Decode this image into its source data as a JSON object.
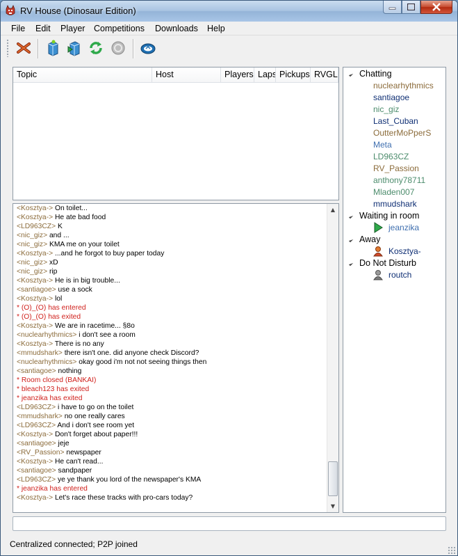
{
  "window": {
    "title": "RV House (Dinosaur Edition)"
  },
  "menu": [
    "File",
    "Edit",
    "Player",
    "Competitions",
    "Downloads",
    "Help"
  ],
  "toolbar": {
    "buttons": [
      "exit-icon",
      "host-icon",
      "join-icon",
      "refresh-icon",
      "stop-icon",
      "connection-icon"
    ]
  },
  "rooms": {
    "columns": [
      "Topic",
      "Host",
      "Players",
      "Laps",
      "Pickups",
      "RVGL"
    ],
    "rows": []
  },
  "chat": {
    "lines": [
      {
        "nick": "<Kosztya->",
        "text": " On toilet...",
        "type": "msg"
      },
      {
        "nick": "<Kosztya->",
        "text": " He ate bad food",
        "type": "msg"
      },
      {
        "nick": "<LD963CZ>",
        "text": " K",
        "type": "msg"
      },
      {
        "nick": "<nic_giz>",
        "text": " and ...",
        "type": "msg"
      },
      {
        "nick": "<nic_giz>",
        "text": " KMA me on your toilet",
        "type": "msg"
      },
      {
        "nick": "<Kosztya->",
        "text": " ...and he forgot to buy paper today",
        "type": "msg"
      },
      {
        "nick": "<nic_giz>",
        "text": " xD",
        "type": "msg"
      },
      {
        "nick": "<nic_giz>",
        "text": " rip",
        "type": "msg"
      },
      {
        "nick": "<Kosztya->",
        "text": " He is in big trouble...",
        "type": "msg"
      },
      {
        "nick": "<santiagoe>",
        "text": " use a sock",
        "type": "msg"
      },
      {
        "nick": "<Kosztya->",
        "text": " lol",
        "type": "msg"
      },
      {
        "nick": "",
        "text": "* (O)_(O) has entered",
        "type": "sys"
      },
      {
        "nick": "",
        "text": "* (O)_(O) has exited",
        "type": "sys"
      },
      {
        "nick": "<Kosztya->",
        "text": " We are in racetime... §8o",
        "type": "msg"
      },
      {
        "nick": "<nuclearhythmics>",
        "text": " i don't see a room",
        "type": "msg"
      },
      {
        "nick": "<Kosztya->",
        "text": " There is no any",
        "type": "msg"
      },
      {
        "nick": "<mmudshark>",
        "text": " there isn't one.  did anyone check Discord?",
        "type": "msg"
      },
      {
        "nick": "<nuclearhythmics>",
        "text": " okay good i'm not not seeing things then",
        "type": "msg"
      },
      {
        "nick": "<santiagoe>",
        "text": " nothing",
        "type": "msg"
      },
      {
        "nick": "",
        "text": "* Room closed (BANKAI)",
        "type": "sys"
      },
      {
        "nick": "",
        "text": "* bleach123 has exited",
        "type": "sys"
      },
      {
        "nick": "",
        "text": "* jeanzika has exited",
        "type": "sys"
      },
      {
        "nick": "<LD963CZ>",
        "text": " i have to go on the toilet",
        "type": "msg"
      },
      {
        "nick": "<mmudshark>",
        "text": " no one really cares",
        "type": "msg"
      },
      {
        "nick": "<LD963CZ>",
        "text": " And i don't see room yet",
        "type": "msg"
      },
      {
        "nick": "<Kosztya->",
        "text": " Don't forget about paper!!!",
        "type": "msg"
      },
      {
        "nick": "<santiagoe>",
        "text": " jeje",
        "type": "msg"
      },
      {
        "nick": "<RV_Passion>",
        "text": " newspaper",
        "type": "msg"
      },
      {
        "nick": "<Kosztya->",
        "text": " He can't read...",
        "type": "msg"
      },
      {
        "nick": "<santiagoe>",
        "text": " sandpaper",
        "type": "msg"
      },
      {
        "nick": "<LD963CZ>",
        "text": " ye ye thank you lord of the newspaper's KMA",
        "type": "msg"
      },
      {
        "nick": "",
        "text": "* jeanzika has entered",
        "type": "sys"
      },
      {
        "nick": "<Kosztya->",
        "text": " Let's race these tracks with pro-cars today?",
        "type": "msg"
      }
    ],
    "input_value": ""
  },
  "users": {
    "groups": [
      {
        "label": "Chatting",
        "members": [
          {
            "name": "nuclearhythmics",
            "color": "#8b6b3a"
          },
          {
            "name": "santiagoe",
            "color": "#0f2f74"
          },
          {
            "name": "nic_giz",
            "color": "#4c8c6c"
          },
          {
            "name": "Last_Cuban",
            "color": "#0f2f74"
          },
          {
            "name": "OutterMoPperS",
            "color": "#8b6b3a"
          },
          {
            "name": "Meta",
            "color": "#3f6faf"
          },
          {
            "name": "LD963CZ",
            "color": "#4c8c6c"
          },
          {
            "name": "RV_Passion",
            "color": "#8b6b3a"
          },
          {
            "name": "anthony78711",
            "color": "#4c8c6c"
          },
          {
            "name": "Mladen007",
            "color": "#4c8c6c"
          },
          {
            "name": "mmudshark",
            "color": "#0f2f74"
          }
        ]
      },
      {
        "label": "Waiting in room",
        "members": [
          {
            "name": "jeanzika",
            "color": "#3f6faf",
            "icon": "play-icon"
          }
        ]
      },
      {
        "label": "Away",
        "members": [
          {
            "name": "Kosztya-",
            "color": "#0f2f74",
            "icon": "away-user-icon"
          }
        ]
      },
      {
        "label": "Do Not Disturb",
        "members": [
          {
            "name": "routch",
            "color": "#0f2f74",
            "icon": "dnd-user-icon"
          }
        ]
      }
    ]
  },
  "status": {
    "text": "Centralized connected; P2P joined"
  },
  "colors": {
    "nick": "#8b6b3a",
    "system": "#d0201c",
    "titlebar": "#a9c4e2"
  }
}
